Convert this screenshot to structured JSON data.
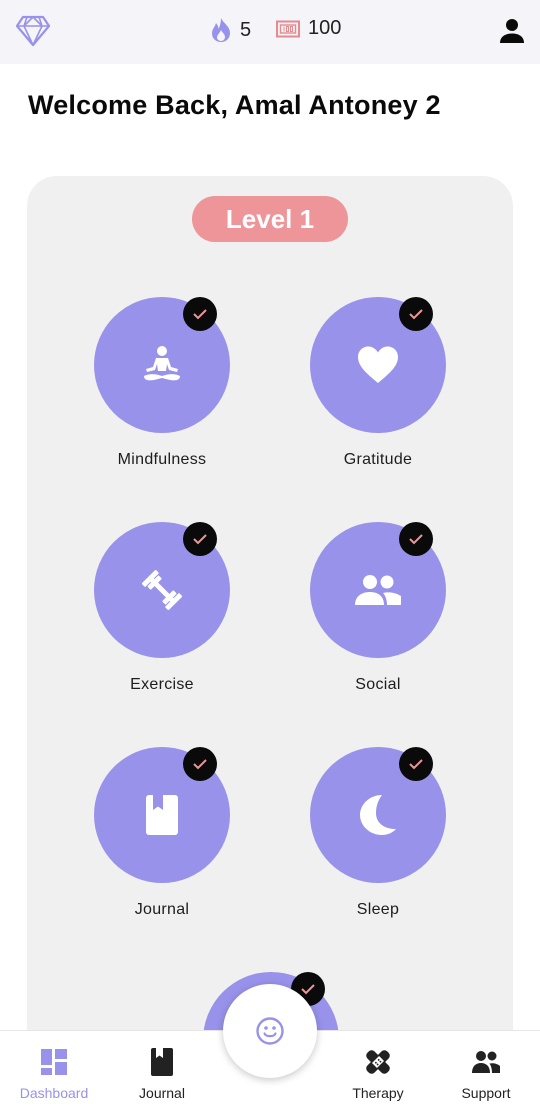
{
  "header": {
    "diamond_icon": "diamond-icon",
    "streak_icon": "flame-icon",
    "streak_count": "5",
    "points_icon": "points-ticket-icon",
    "points_count": "100",
    "profile_icon": "person-icon"
  },
  "welcome": "Welcome Back, Amal Antoney 2",
  "level": "Level 1",
  "activities": [
    {
      "label": "Mindfulness",
      "icon": "meditation-icon",
      "completed": true
    },
    {
      "label": "Gratitude",
      "icon": "heart-icon",
      "completed": true
    },
    {
      "label": "Exercise",
      "icon": "dumbbell-icon",
      "completed": true
    },
    {
      "label": "Social",
      "icon": "people-icon",
      "completed": true
    },
    {
      "label": "Journal",
      "icon": "book-icon",
      "completed": true
    },
    {
      "label": "Sleep",
      "icon": "moon-icon",
      "completed": true
    }
  ],
  "nav": {
    "items": [
      {
        "label": "Dashboard",
        "icon": "dashboard-icon",
        "active": true
      },
      {
        "label": "Journal",
        "icon": "book-icon",
        "active": false
      },
      {
        "label": "Therapy",
        "icon": "bandage-icon",
        "active": false
      },
      {
        "label": "Support",
        "icon": "people-icon",
        "active": false
      }
    ],
    "fab_icon": "smiley-icon"
  },
  "colors": {
    "accent": "#9892ea",
    "level_pill": "#ed9599",
    "check_mark": "#ed9599",
    "topbar_bg": "#f4f4f9",
    "card_bg": "#f0f0f0"
  }
}
